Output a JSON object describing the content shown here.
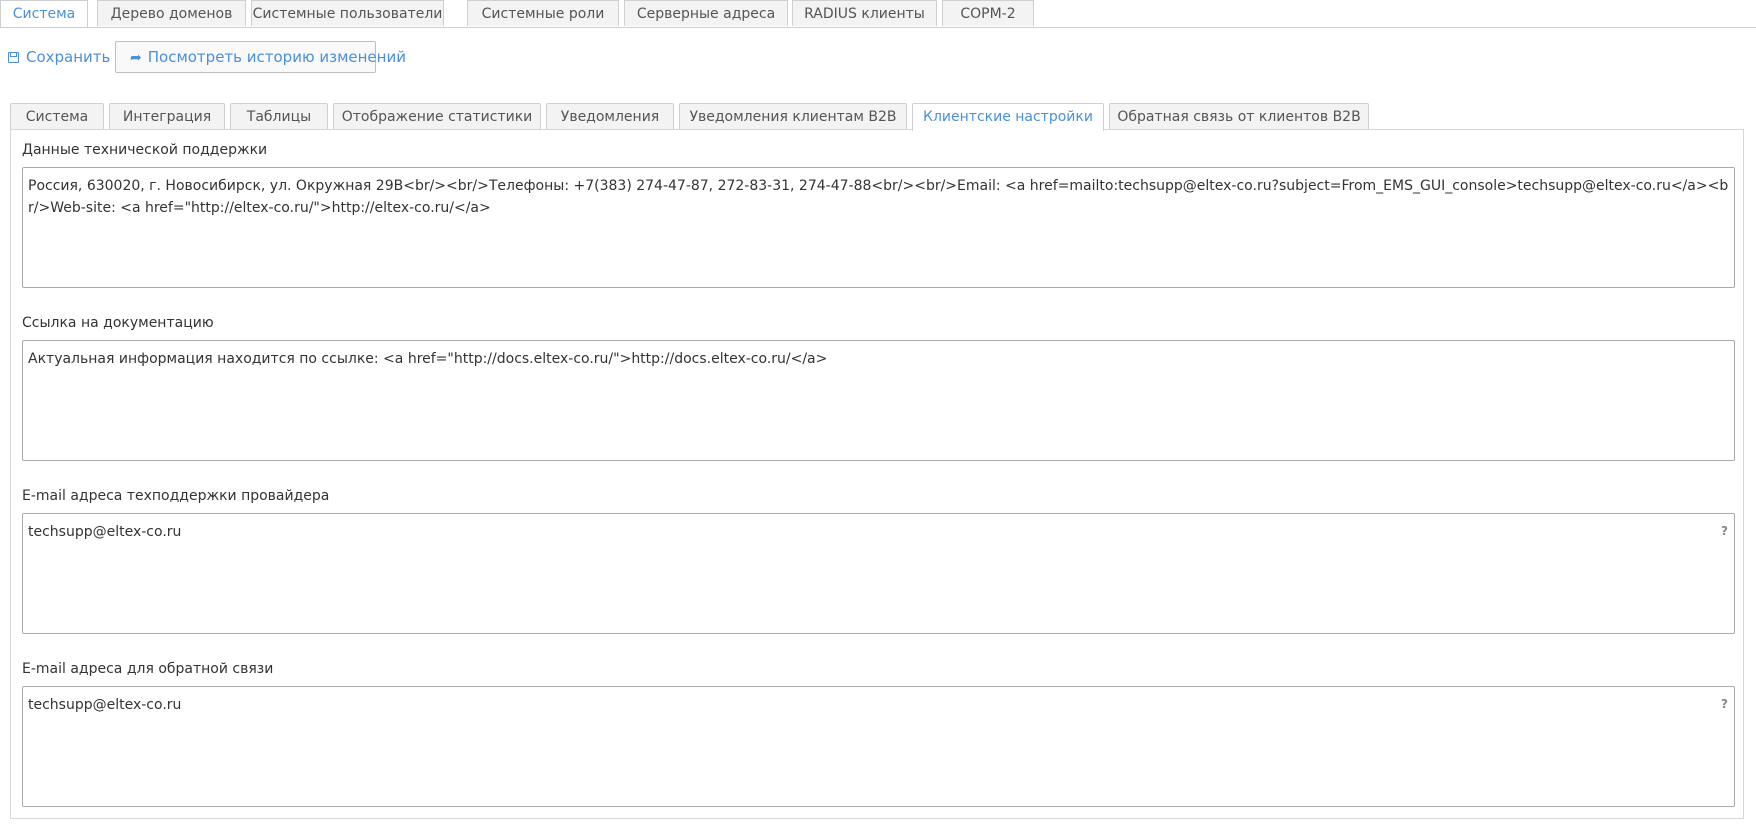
{
  "top_tabs": [
    {
      "label": "Система",
      "active": true
    },
    {
      "label": "Дерево доменов",
      "active": false
    },
    {
      "label": "Системные пользователи",
      "active": false
    },
    {
      "label": "Системные роли",
      "active": false
    },
    {
      "label": "Серверные адреса",
      "active": false
    },
    {
      "label": "RADIUS клиенты",
      "active": false
    },
    {
      "label": "СОРМ-2",
      "active": false
    }
  ],
  "toolbar": {
    "save_label": "Сохранить",
    "history_label": "Посмотреть историю изменений"
  },
  "sub_tabs": [
    {
      "label": "Система",
      "active": false
    },
    {
      "label": "Интеграция",
      "active": false
    },
    {
      "label": "Таблицы",
      "active": false
    },
    {
      "label": "Отображение статистики",
      "active": false
    },
    {
      "label": "Уведомления",
      "active": false
    },
    {
      "label": "Уведомления клиентам B2B",
      "active": false
    },
    {
      "label": "Клиентские настройки",
      "active": true
    },
    {
      "label": "Обратная связь от клиентов B2B",
      "active": false
    }
  ],
  "fields": {
    "support": {
      "label": "Данные технической поддержки",
      "value": "Россия, 630020, г. Новосибирск, ул. Окружная 29В<br/><br/>Телефоны: +7(383) 274-47-87, 272-83-31, 274-47-88<br/><br/>Email:  <a href=mailto:techsupp@eltex-co.ru?subject=From_EMS_GUI_console>techsupp@eltex-co.ru</a><br/>Web-site: <a href=\"http://eltex-co.ru/\">http://eltex-co.ru/</a>"
    },
    "docs": {
      "label": "Ссылка на документацию",
      "value": "Актуальная информация находится по ссылке: <a href=\"http://docs.eltex-co.ru/\">http://docs.eltex-co.ru/</a>"
    },
    "provider_email": {
      "label": "E-mail адреса техподдержки провайдера",
      "value": "techsupp@eltex-co.ru",
      "help": "?"
    },
    "feedback_email": {
      "label": "E-mail адреса для обратной связи",
      "value": "techsupp@eltex-co.ru",
      "help": "?"
    }
  }
}
